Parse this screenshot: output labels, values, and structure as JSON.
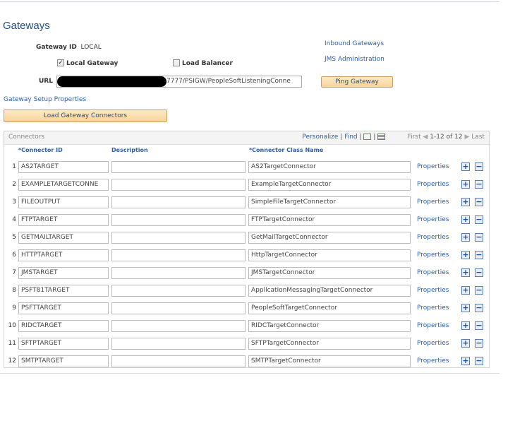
{
  "page": {
    "title": "Gateways"
  },
  "gateway": {
    "id_label": "Gateway ID",
    "id_value": "LOCAL",
    "local_gateway_label": "Local Gateway",
    "local_gateway_checked": true,
    "load_balancer_label": "Load Balancer",
    "load_balancer_checked": false,
    "url_label": "URL",
    "url_value": "7777/PSIGW/PeopleSoftListeningConne",
    "ping_button": "Ping Gateway",
    "setup_link": "Gateway Setup Properties",
    "load_connectors_button": "Load Gateway Connectors"
  },
  "links": {
    "inbound": "Inbound Gateways",
    "jms": "JMS Administration"
  },
  "grid": {
    "title": "Connectors",
    "personalize": "Personalize",
    "find": "Find",
    "first": "First",
    "range": "1-12 of 12",
    "last": "Last",
    "col_connector_id": "*Connector ID",
    "col_description": "Description",
    "col_class": "*Connector Class Name",
    "properties_label": "Properties",
    "rows": [
      {
        "num": "1",
        "id": "AS2TARGET",
        "desc": "",
        "cls": "AS2TargetConnector"
      },
      {
        "num": "2",
        "id": "EXAMPLETARGETCONNE",
        "desc": "",
        "cls": "ExampleTargetConnector"
      },
      {
        "num": "3",
        "id": "FILEOUTPUT",
        "desc": "",
        "cls": "SimpleFileTargetConnector"
      },
      {
        "num": "4",
        "id": "FTPTARGET",
        "desc": "",
        "cls": "FTPTargetConnector"
      },
      {
        "num": "5",
        "id": "GETMAILTARGET",
        "desc": "",
        "cls": "GetMailTargetConnector"
      },
      {
        "num": "6",
        "id": "HTTPTARGET",
        "desc": "",
        "cls": "HttpTargetConnector"
      },
      {
        "num": "7",
        "id": "JMSTARGET",
        "desc": "",
        "cls": "JMSTargetConnector"
      },
      {
        "num": "8",
        "id": "PSFT81TARGET",
        "desc": "",
        "cls": "ApplicationMessagingTargetConnector"
      },
      {
        "num": "9",
        "id": "PSFTTARGET",
        "desc": "",
        "cls": "PeopleSoftTargetConnector"
      },
      {
        "num": "10",
        "id": "RIDCTARGET",
        "desc": "",
        "cls": "RIDCTargetConnector"
      },
      {
        "num": "11",
        "id": "SFTPTARGET",
        "desc": "",
        "cls": "SFTPTargetConnector"
      },
      {
        "num": "12",
        "id": "SMTPTARGET",
        "desc": "",
        "cls": "SMTPTargetConnector"
      }
    ]
  },
  "icons": {
    "add": "plus-icon",
    "remove": "minus-icon",
    "zoom": "zoom-icon",
    "download": "download-grid-icon",
    "prev": "prev-arrow-icon",
    "next": "next-arrow-icon"
  }
}
